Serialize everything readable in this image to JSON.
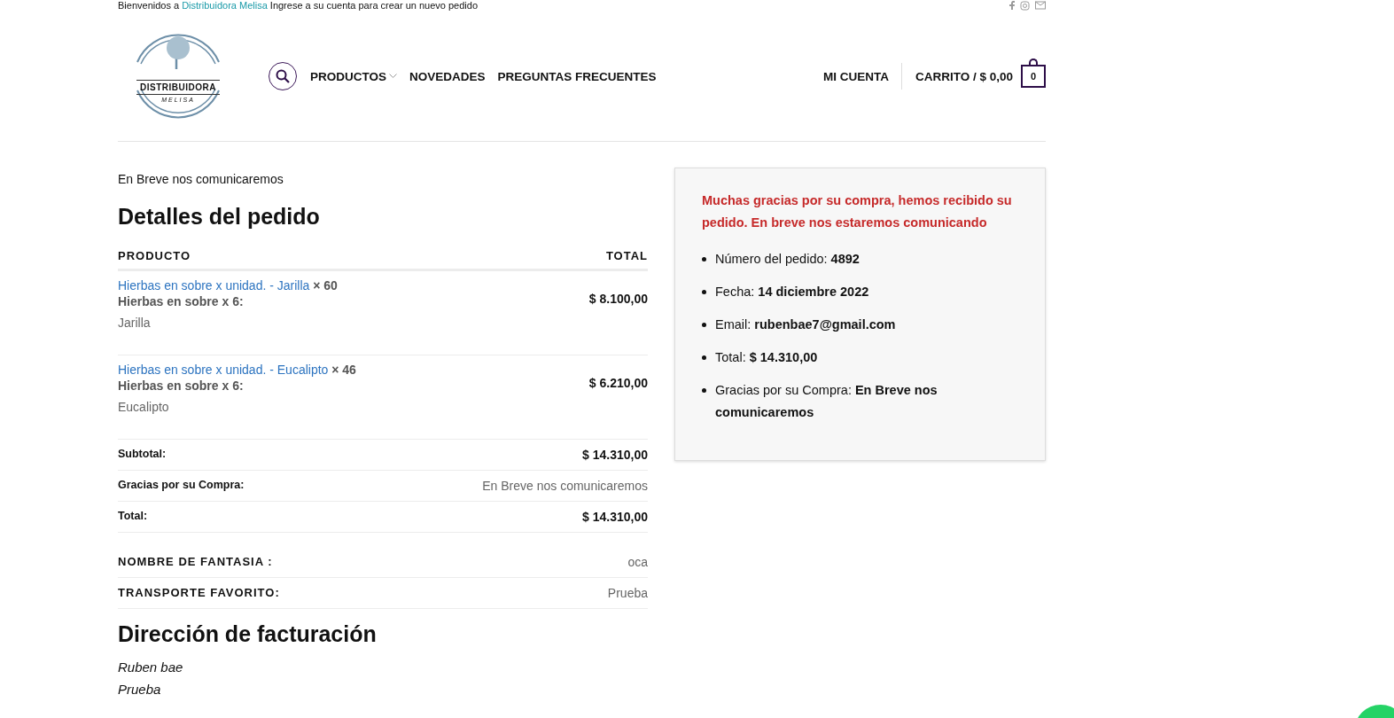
{
  "top_bar": {
    "text_before": "Bienvenidos a",
    "link": "Distribuidora Melisa",
    "text_after": "Ingrese a su cuenta para crear un nuevo pedido"
  },
  "logo": {
    "title": "DISTRIBUIDORA",
    "subtitle": "MELISA"
  },
  "nav": [
    {
      "label": "PRODUCTOS",
      "has_dropdown": true
    },
    {
      "label": "NOVEDADES",
      "has_dropdown": false
    },
    {
      "label": "PREGUNTAS FRECUENTES",
      "has_dropdown": false
    }
  ],
  "account": "MI CUENTA",
  "cart": {
    "label": "CARRITO / $ 0,00",
    "count": "0"
  },
  "intro": "En Breve nos comunicaremos",
  "order_details": {
    "title": "Detalles del pedido",
    "columns": [
      "PRODUCTO",
      "TOTAL"
    ],
    "items": [
      {
        "name": "Hierbas en sobre x unidad. - Jarilla",
        "quantity": "× 60",
        "meta_label": "Hierbas en sobre x 6:",
        "meta_value": "Jarilla",
        "total": "$ 8.100,00"
      },
      {
        "name": "Hierbas en sobre x unidad. - Eucalipto",
        "quantity": "× 46",
        "meta_label": "Hierbas en sobre x 6:",
        "meta_value": "Eucalipto",
        "total": "$ 6.210,00"
      }
    ],
    "totals": [
      {
        "label": "Subtotal:",
        "value": "$ 14.310,00",
        "kind": "amount"
      },
      {
        "label": "Gracias por su Compra:",
        "value": "En Breve nos comunicaremos",
        "kind": "note"
      },
      {
        "label": "Total:",
        "value": "$ 14.310,00",
        "kind": "amount"
      }
    ],
    "extra_fields": [
      {
        "label": "NOMBRE DE FANTASIA :",
        "value": "oca"
      },
      {
        "label": "TRANSPORTE FAVORITO:",
        "value": "Prueba"
      }
    ]
  },
  "billing": {
    "title": "Dirección de facturación",
    "lines": [
      "Ruben bae",
      "Prueba"
    ]
  },
  "thanks_box": {
    "message": "Muchas gracias por su compra, hemos recibido su pedido. En breve nos estaremos comunicando",
    "items": [
      "Número del pedido: **4892**",
      "Fecha: **14 diciembre 2022**",
      "Email: **rubenbae7@gmail.com**",
      "Total: **$ 14.310,00**",
      "Gracias por su Compra: **En Breve nos comunicaremos**"
    ]
  }
}
